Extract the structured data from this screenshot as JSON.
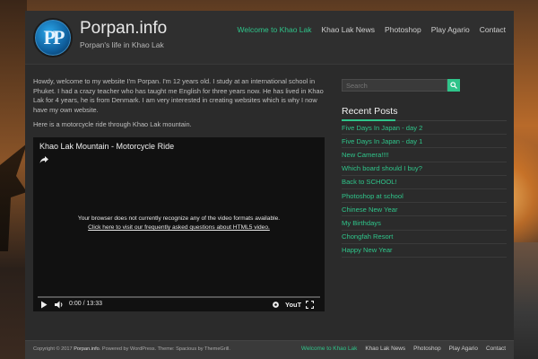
{
  "site": {
    "title": "Porpan.info",
    "tagline": "Porpan's life in Khao Lak",
    "logo_text": "PP"
  },
  "nav": {
    "items": [
      {
        "label": "Welcome to Khao Lak",
        "active": true
      },
      {
        "label": "Khao Lak News",
        "active": false
      },
      {
        "label": "Photoshop",
        "active": false
      },
      {
        "label": "Play Agario",
        "active": false
      },
      {
        "label": "Contact",
        "active": false
      }
    ]
  },
  "content": {
    "intro": "Howdy, welcome to my website I'm Porpan. I'm 12 years old. I study at an  international school  in Phuket. I had a crazy teacher who has taught me English for three years now. He has lived in Khao Lak for 4 years, he is from Denmark. I am very interested in creating websites which is why I now have my own website.",
    "lead": "Here is a motorcycle ride through Khao Lak mountain."
  },
  "video": {
    "title": "Khao Lak Mountain - Motorcycle Ride",
    "message": "Your browser does not currently recognize any of the video formats available.",
    "help_link": "Click here to visit our frequently asked questions about HTML5 video.",
    "time": "0:00 / 13:33",
    "brand": "YouTube",
    "progress": 0
  },
  "sidebar": {
    "search_placeholder": "Search",
    "recent_title": "Recent Posts",
    "posts": [
      "Five Days In Japan - day 2",
      "Five Days In Japan - day 1",
      "New Camera!!!!",
      "Which board should I buy?",
      "Back to SCHOOL!",
      "Photoshop at school",
      "Chinese New Year",
      "My Birthdays",
      "Chongfah Resort",
      "Happy New Year"
    ]
  },
  "footer": {
    "copyright_prefix": "Copyright © 2017",
    "copyright_site": "Porpan.info",
    "copyright_suffix": ". Powered by WordPress. Theme: Spacious by ThemeGrill.",
    "nav": [
      {
        "label": "Welcome to Khao Lak",
        "active": true
      },
      {
        "label": "Khao Lak News",
        "active": false
      },
      {
        "label": "Photoshop",
        "active": false
      },
      {
        "label": "Play Agario",
        "active": false
      },
      {
        "label": "Contact",
        "active": false
      }
    ]
  },
  "colors": {
    "accent": "#2fc48a",
    "panel": "#2b2b2b"
  }
}
